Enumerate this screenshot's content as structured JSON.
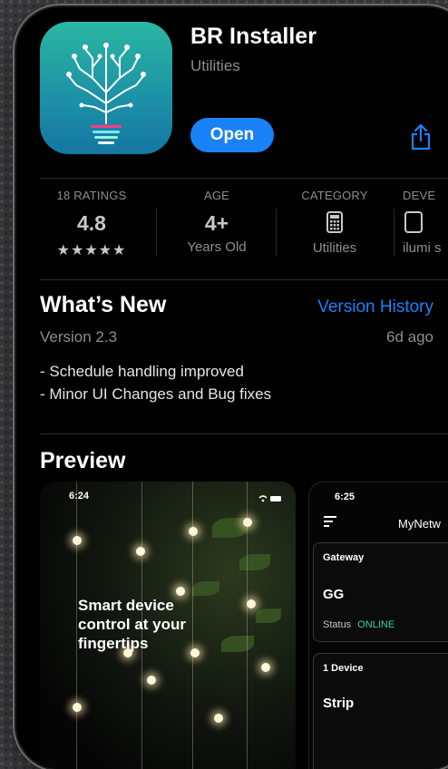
{
  "app": {
    "title": "BR Installer",
    "category": "Utilities",
    "open_label": "Open",
    "share_icon": "share-icon"
  },
  "stats": [
    {
      "label": "18 RATINGS",
      "value": "4.8",
      "stars": "★★★★★"
    },
    {
      "label": "AGE",
      "value": "4+",
      "sub": "Years Old"
    },
    {
      "label": "CATEGORY",
      "icon": "calculator-icon",
      "sub": "Utilities"
    },
    {
      "label": "DEVE",
      "icon": "developer-icon",
      "sub": "ilumi s"
    }
  ],
  "whats_new": {
    "heading": "What’s New",
    "history_link": "Version History",
    "version": "Version 2.3",
    "ago": "6d ago",
    "notes": [
      "- Schedule handling improved",
      "- Minor UI Changes and Bug fixes"
    ]
  },
  "preview": {
    "heading": "Preview",
    "shot1": {
      "time": "6:24",
      "promo_lines": [
        "Smart device",
        "control at your",
        "fingertips"
      ]
    },
    "shot2": {
      "time": "6:25",
      "title": "MyNetw",
      "gateway_label": "Gateway",
      "gateway_name": "GG",
      "status_label": "Status",
      "status_value": "ONLINE",
      "device_label": "1 Device",
      "device_name": "Strip"
    }
  },
  "colors": {
    "accent": "#1a82f7",
    "online": "#2fd3a0"
  }
}
